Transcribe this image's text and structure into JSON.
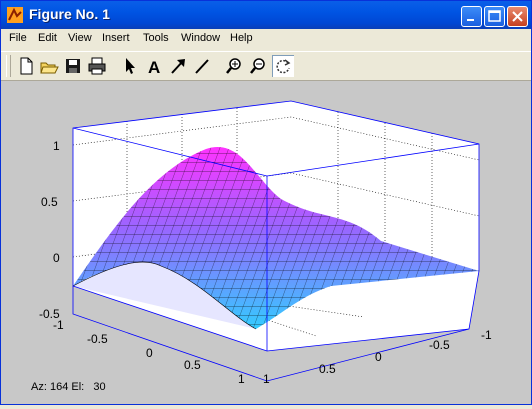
{
  "window": {
    "title": "Figure No. 1"
  },
  "menu": [
    "File",
    "Edit",
    "View",
    "Insert",
    "Tools",
    "Window",
    "Help"
  ],
  "toolbar": [
    {
      "name": "new-figure-button",
      "icon": "new-file-icon"
    },
    {
      "name": "open-button",
      "icon": "folder-open-icon"
    },
    {
      "name": "save-button",
      "icon": "floppy-icon"
    },
    {
      "name": "print-button",
      "icon": "printer-icon"
    },
    {
      "name": "edit-plot-button",
      "icon": "arrow-pointer-icon"
    },
    {
      "name": "insert-text-button",
      "icon": "letter-a-icon",
      "label": "A"
    },
    {
      "name": "insert-arrow-button",
      "icon": "arrow-icon"
    },
    {
      "name": "insert-line-button",
      "icon": "line-icon"
    },
    {
      "name": "zoom-in-button",
      "icon": "zoom-in-icon"
    },
    {
      "name": "zoom-out-button",
      "icon": "zoom-out-icon"
    },
    {
      "name": "rotate-3d-button",
      "icon": "rotate-icon",
      "pressed": true
    }
  ],
  "plot": {
    "z_ticks": [
      "1",
      "0.5",
      "0",
      "-0.5"
    ],
    "x_ticks": [
      "-1",
      "-0.5",
      "0",
      "0.5",
      "1"
    ],
    "y_ticks": [
      "1",
      "0.5",
      "0",
      "-0.5",
      "-1"
    ],
    "colors": {
      "surface_high": "#ff33ff",
      "surface_low": "#33ccff",
      "box": "#0000ff",
      "background": "#c8c8c8",
      "axes_face": "#ffffff"
    }
  },
  "chart_data": {
    "type": "surface",
    "xlim": [
      -1,
      1
    ],
    "ylim": [
      -1,
      1
    ],
    "zlim": [
      -0.5,
      1
    ],
    "peak": {
      "x": -0.4,
      "y": 0.2,
      "z": 1.0
    },
    "grid": true
  },
  "status": {
    "az_label": "Az:",
    "az_value": "164",
    "el_label": "El:",
    "el_value": "30"
  }
}
